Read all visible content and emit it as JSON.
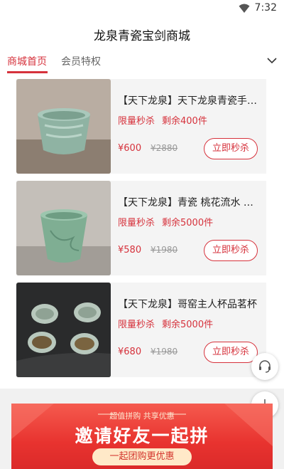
{
  "status_bar": {
    "time": "7:32",
    "wifi_icon": "wifi-icon"
  },
  "app_bar": {
    "title": "龙泉青瓷宝剑商城"
  },
  "tabs": [
    {
      "label": "商城首页",
      "active": true
    },
    {
      "label": "会员特权",
      "active": false
    }
  ],
  "tab_menu_icon": "chevron-down-icon",
  "products": [
    {
      "name": "【天下龙泉】天下龙泉青瓷手工茶杯",
      "flash_label": "限量秒杀",
      "stock": "剩余400件",
      "price": "¥600",
      "original_price": "¥2880",
      "buy_label": "立即秒杀"
    },
    {
      "name": "【天下龙泉】青瓷 桃花流水 主人杯",
      "flash_label": "限量秒杀",
      "stock": "剩余5000件",
      "price": "¥580",
      "original_price": "¥1980",
      "buy_label": "立即秒杀"
    },
    {
      "name": "【天下龙泉】哥窑主人杯品茗杯",
      "flash_label": "限量秒杀",
      "stock": "剩余5000件",
      "price": "¥680",
      "original_price": "¥1980",
      "buy_label": "立即秒杀"
    }
  ],
  "floating_buttons": {
    "service_icon": "customer-service-icon",
    "add_icon": "plus-icon"
  },
  "banner": {
    "tagline": "超值拼购 共享优惠",
    "headline": "邀请好友一起拼",
    "cta": "一起团购更优惠"
  },
  "colors": {
    "accent": "#d6323c",
    "banner_red": "#e8332f",
    "pill_cream": "#ffe9c8"
  }
}
